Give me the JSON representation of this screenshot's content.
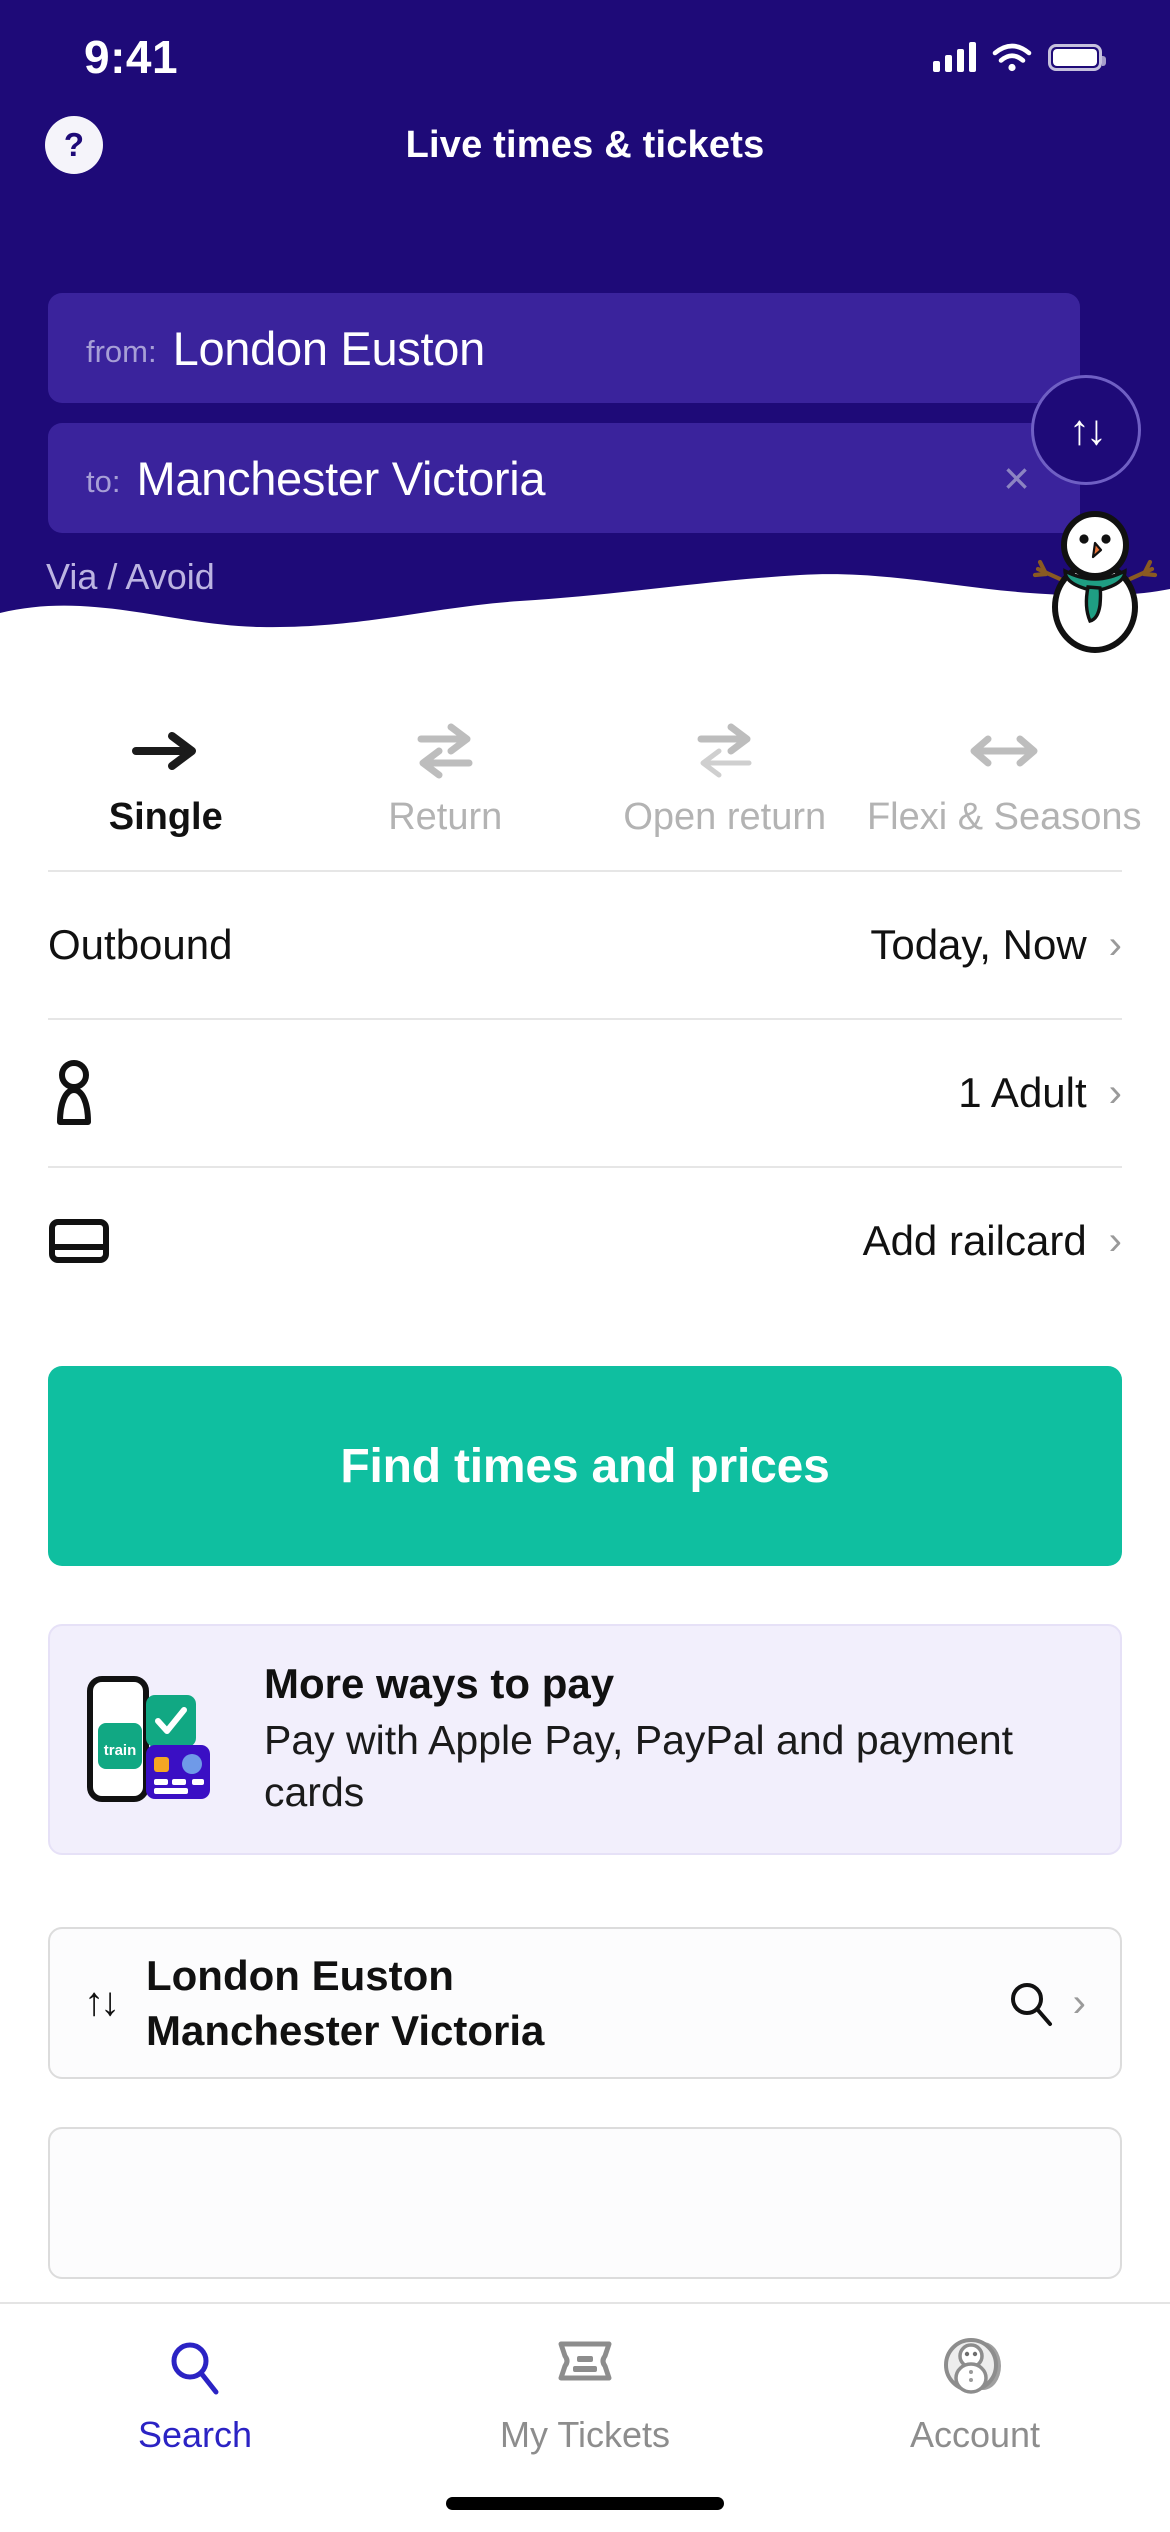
{
  "status_bar": {
    "time": "9:41",
    "signal_icon": "cellular-signal-icon",
    "wifi_icon": "wifi-icon",
    "battery_icon": "battery-icon"
  },
  "header": {
    "title": "Live times & tickets",
    "help_label": "?",
    "from": {
      "label": "from:",
      "value": "London Euston"
    },
    "to": {
      "label": "to:",
      "value": "Manchester Victoria",
      "clear_label": "×"
    },
    "swap_label": "↑↓",
    "via_avoid": "Via / Avoid",
    "background_color": "#1e0a78",
    "field_color": "#3a239c",
    "snowman_scarf_color": "#1f9e83"
  },
  "ticket_tabs": [
    {
      "label": "Single",
      "icon": "arrow-right-icon",
      "active": true
    },
    {
      "label": "Return",
      "icon": "return-arrows-icon",
      "active": false
    },
    {
      "label": "Open return",
      "icon": "open-return-arrows-icon",
      "active": false
    },
    {
      "label": "Flexi & Seasons",
      "icon": "double-arrow-icon",
      "active": false
    }
  ],
  "options": [
    {
      "name": "outbound",
      "label": "Outbound",
      "value": "Today, Now",
      "icon": null
    },
    {
      "name": "passengers",
      "label": "",
      "value": "1 Adult",
      "icon": "person-icon"
    },
    {
      "name": "railcard",
      "label": "",
      "value": "Add railcard",
      "icon": "railcard-icon"
    }
  ],
  "cta": {
    "label": "Find times and prices",
    "color": "#0fbfa0"
  },
  "pay_card": {
    "title": "More ways to pay",
    "subtitle": "Pay with Apple Pay, PayPal and payment cards",
    "phone_badge_text": "train",
    "icon": "phone-and-card-icon",
    "background_color": "#f2effc"
  },
  "recent_search": {
    "swap_icon": "up-down-arrows-icon",
    "origin": "London Euston",
    "destination": "Manchester Victoria",
    "search_icon": "search-icon",
    "chevron": "›"
  },
  "tab_bar": [
    {
      "label": "Search",
      "icon": "search-icon",
      "active": true
    },
    {
      "label": "My Tickets",
      "icon": "ticket-icon",
      "active": false
    },
    {
      "label": "Account",
      "icon": "account-avatar-icon",
      "active": false
    }
  ],
  "accent_colors": {
    "brand_purple": "#1e0a78",
    "cta_green": "#0fbfa0",
    "active_tab_blue": "#2b23c4"
  }
}
